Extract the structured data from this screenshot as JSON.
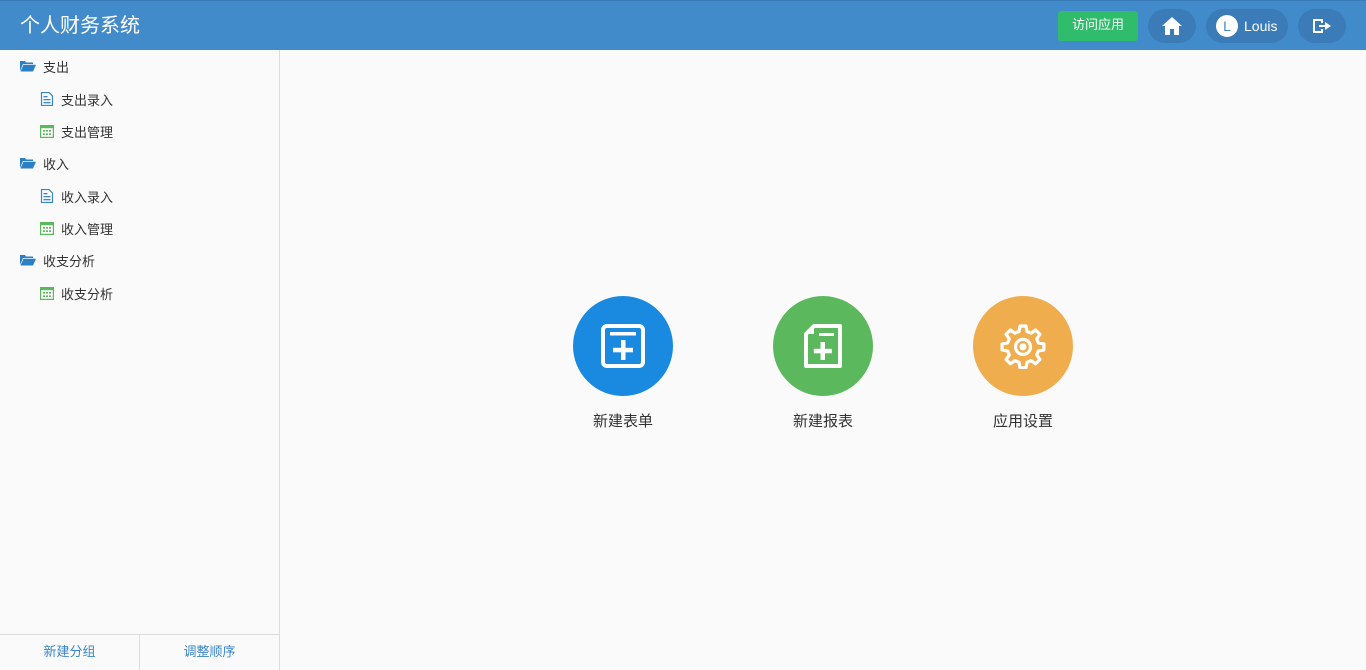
{
  "header": {
    "title": "个人财务系统",
    "visit_app_label": "访问应用",
    "user": {
      "initial": "L",
      "name": "Louis"
    }
  },
  "sidebar": {
    "groups": [
      {
        "label": "支出",
        "items": [
          {
            "label": "支出录入",
            "icon": "form-icon"
          },
          {
            "label": "支出管理",
            "icon": "table-icon"
          }
        ]
      },
      {
        "label": "收入",
        "items": [
          {
            "label": "收入录入",
            "icon": "form-icon"
          },
          {
            "label": "收入管理",
            "icon": "table-icon"
          }
        ]
      },
      {
        "label": "收支分析",
        "items": [
          {
            "label": "收支分析",
            "icon": "table-icon"
          }
        ]
      }
    ],
    "footer": {
      "new_group_label": "新建分组",
      "reorder_label": "调整顺序"
    }
  },
  "main": {
    "actions": [
      {
        "label": "新建表单",
        "color": "#1a8ae0",
        "icon": "new-form-icon"
      },
      {
        "label": "新建报表",
        "color": "#5cb85c",
        "icon": "new-report-icon"
      },
      {
        "label": "应用设置",
        "color": "#f0ad4e",
        "icon": "gear-icon"
      }
    ]
  },
  "colors": {
    "header": "#428bca",
    "visit_button": "#2fbc6b",
    "folder_icon": "#2a7fc5",
    "form_icon": "#3a86c8",
    "table_icon": "#5cb85c"
  }
}
